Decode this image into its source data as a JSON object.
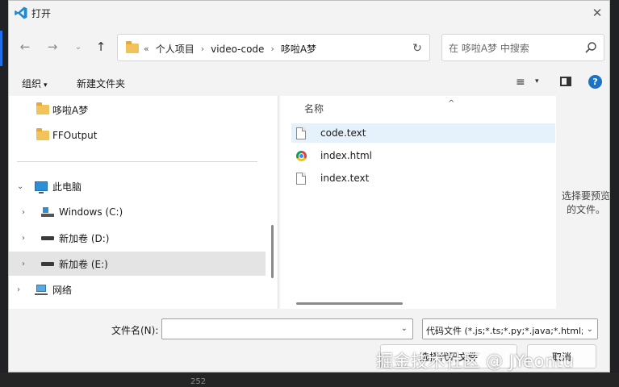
{
  "window": {
    "title": "打开",
    "app_icon": "vscode-icon",
    "close_glyph": "✕"
  },
  "nav": {
    "back_glyph": "←",
    "forward_glyph": "→",
    "recent_glyph": "⌄",
    "up_glyph": "↑",
    "refresh_glyph": "↻"
  },
  "address": {
    "overflow": "«",
    "path": [
      "个人项目",
      "video-code",
      "哆啦A梦"
    ]
  },
  "search": {
    "placeholder": "在 哆啦A梦 中搜索"
  },
  "toolbar": {
    "organize_label": "组织",
    "organize_caret": "▾",
    "new_folder_label": "新建文件夹",
    "view_glyph": "≡",
    "view_caret": "▾",
    "help_glyph": "?"
  },
  "sidebar": {
    "items": [
      {
        "label": "哆啦A梦",
        "icon": "folder-icon"
      },
      {
        "label": "FFOutput",
        "icon": "folder-icon"
      },
      {
        "label": "此电脑",
        "icon": "computer-icon",
        "chevron": "⌄"
      },
      {
        "label": "Windows (C:)",
        "icon": "windows-drive-icon",
        "chevron": "›"
      },
      {
        "label": "新加卷 (D:)",
        "icon": "drive-icon",
        "chevron": "›"
      },
      {
        "label": "新加卷 (E:)",
        "icon": "drive-icon",
        "chevron": "›",
        "selected": true
      },
      {
        "label": "网络",
        "icon": "network-icon",
        "chevron": "›"
      }
    ]
  },
  "files": {
    "column_name": "名称",
    "sort_glyph": "^",
    "rows": [
      {
        "name": "code.text",
        "icon": "document-icon"
      },
      {
        "name": "index.html",
        "icon": "chrome-icon"
      },
      {
        "name": "index.text",
        "icon": "document-icon"
      }
    ]
  },
  "preview": {
    "message": "选择要预览的文件。"
  },
  "bottom": {
    "filename_label": "文件名(N):",
    "filename_value": "",
    "filter_value": "代码文件 (*.js;*.ts;*.py;*.java;*.html;",
    "caret_glyph": "⌄",
    "open_button": "选择代码文件",
    "cancel_button": "取消"
  },
  "watermark": "掘金技术社区 @ JYeontu",
  "background": {
    "line_number": "252"
  },
  "colors": {
    "accent": "#1a73c7",
    "hover_row": "#e5f1fb",
    "selected_nav": "#e4e4e4",
    "dialog_bg": "#f3f3f3"
  }
}
